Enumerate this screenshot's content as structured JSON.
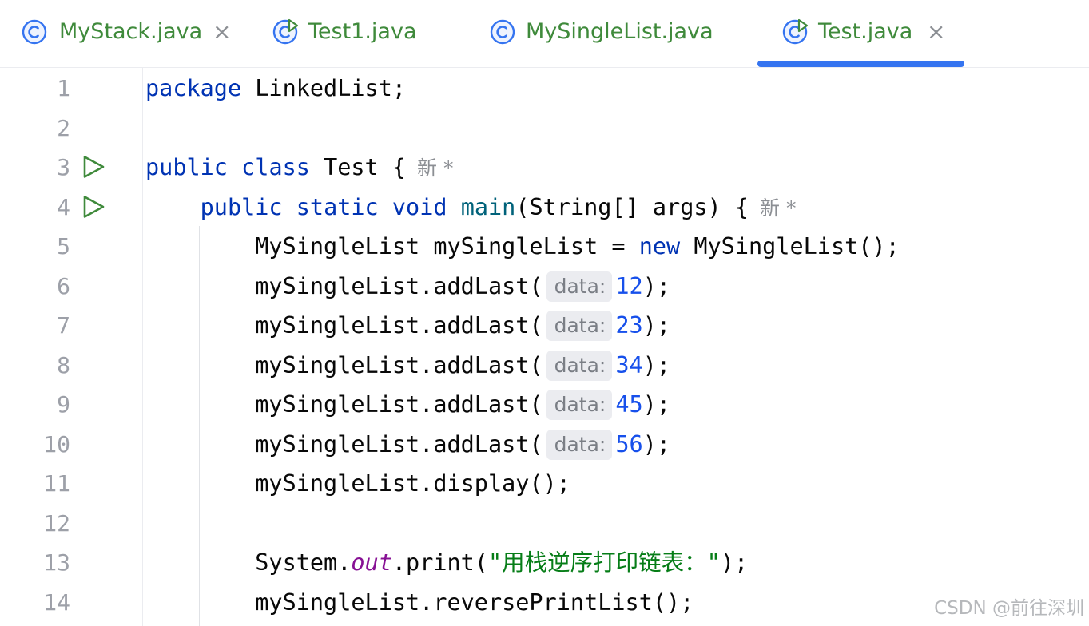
{
  "tabs": [
    {
      "label": "MyStack.java",
      "icon": "class-icon",
      "closable": true
    },
    {
      "label": "Test1.java",
      "icon": "runnable-class-icon",
      "closable": false
    },
    {
      "label": "MySingleList.java",
      "icon": "class-icon",
      "closable": false
    },
    {
      "label": "Test.java",
      "icon": "runnable-class-icon",
      "closable": true,
      "active": true
    }
  ],
  "tab_close_glyph": "×",
  "colors": {
    "tab_text": "#3f8a3b",
    "active_underline": "#3574f0",
    "keyword": "#0033b3",
    "number": "#1750eb",
    "string": "#067d17",
    "static_field": "#871094",
    "run_icon": "#3f8a3b"
  },
  "editor": {
    "lines": [
      {
        "num": "1",
        "parts": [
          {
            "t": "package",
            "c": "kw"
          },
          {
            "t": " LinkedList;"
          }
        ]
      },
      {
        "num": "2",
        "parts": []
      },
      {
        "num": "3",
        "run": true,
        "parts": [
          {
            "t": "public",
            "c": "kw"
          },
          {
            "t": " "
          },
          {
            "t": "class",
            "c": "kw"
          },
          {
            "t": " Test {"
          }
        ],
        "author": "新 *"
      },
      {
        "num": "4",
        "run": true,
        "parts": [
          {
            "t": "    "
          },
          {
            "t": "public",
            "c": "kw"
          },
          {
            "t": " "
          },
          {
            "t": "static",
            "c": "kw"
          },
          {
            "t": " "
          },
          {
            "t": "void",
            "c": "kw"
          },
          {
            "t": " "
          },
          {
            "t": "main",
            "c": "fn"
          },
          {
            "t": "(String[] args) {"
          }
        ],
        "author": "新 *"
      },
      {
        "num": "5",
        "parts": [
          {
            "t": "        MySingleList mySingleList = "
          },
          {
            "t": "new",
            "c": "kw"
          },
          {
            "t": " MySingleList();"
          }
        ]
      },
      {
        "num": "6",
        "parts": [
          {
            "t": "        mySingleList.addLast("
          },
          {
            "hint": "data:"
          },
          {
            "t": "12",
            "c": "num"
          },
          {
            "t": ");"
          }
        ]
      },
      {
        "num": "7",
        "parts": [
          {
            "t": "        mySingleList.addLast("
          },
          {
            "hint": "data:"
          },
          {
            "t": "23",
            "c": "num"
          },
          {
            "t": ");"
          }
        ]
      },
      {
        "num": "8",
        "parts": [
          {
            "t": "        mySingleList.addLast("
          },
          {
            "hint": "data:"
          },
          {
            "t": "34",
            "c": "num"
          },
          {
            "t": ");"
          }
        ]
      },
      {
        "num": "9",
        "parts": [
          {
            "t": "        mySingleList.addLast("
          },
          {
            "hint": "data:"
          },
          {
            "t": "45",
            "c": "num"
          },
          {
            "t": ");"
          }
        ]
      },
      {
        "num": "10",
        "parts": [
          {
            "t": "        mySingleList.addLast("
          },
          {
            "hint": "data:"
          },
          {
            "t": "56",
            "c": "num"
          },
          {
            "t": ");"
          }
        ]
      },
      {
        "num": "11",
        "parts": [
          {
            "t": "        mySingleList.display();"
          }
        ]
      },
      {
        "num": "12",
        "parts": []
      },
      {
        "num": "13",
        "parts": [
          {
            "t": "        System."
          },
          {
            "t": "out",
            "c": "field"
          },
          {
            "t": ".print("
          },
          {
            "t": "\"用栈逆序打印链表：\"",
            "c": "str"
          },
          {
            "t": ");"
          }
        ]
      },
      {
        "num": "14",
        "parts": [
          {
            "t": "        mySingleList.reversePrintList();"
          }
        ]
      }
    ]
  },
  "watermark": "CSDN @前往深圳"
}
